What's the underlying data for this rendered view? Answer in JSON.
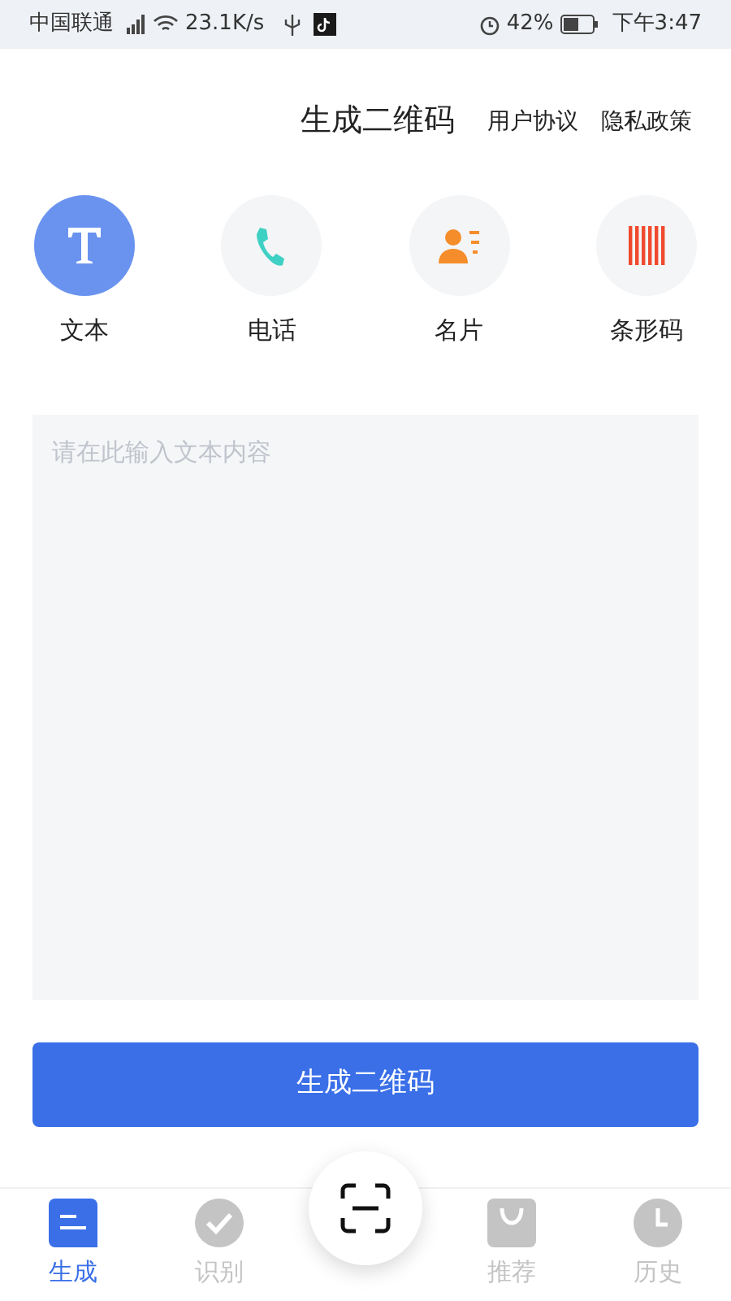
{
  "status_bar": {
    "carrier": "中国联通",
    "network_speed": "23.1K/s",
    "battery": "42%",
    "time": "下午3:47"
  },
  "header": {
    "title": "生成二维码",
    "links": [
      "用户协议",
      "隐私政策"
    ]
  },
  "types": [
    {
      "kind": "text",
      "label": "文本",
      "selected": true
    },
    {
      "kind": "phone",
      "label": "电话",
      "selected": false
    },
    {
      "kind": "card",
      "label": "名片",
      "selected": false
    },
    {
      "kind": "barcode",
      "label": "条形码",
      "selected": false
    }
  ],
  "input": {
    "placeholder": "请在此输入文本内容"
  },
  "generate_button": "生成二维码",
  "tabs": [
    {
      "kind": "generate",
      "label": "生成",
      "selected": true
    },
    {
      "kind": "recognize",
      "label": "识别",
      "selected": false
    },
    {
      "kind": "recommend",
      "label": "推荐",
      "selected": false
    },
    {
      "kind": "history",
      "label": "历史",
      "selected": false
    }
  ]
}
